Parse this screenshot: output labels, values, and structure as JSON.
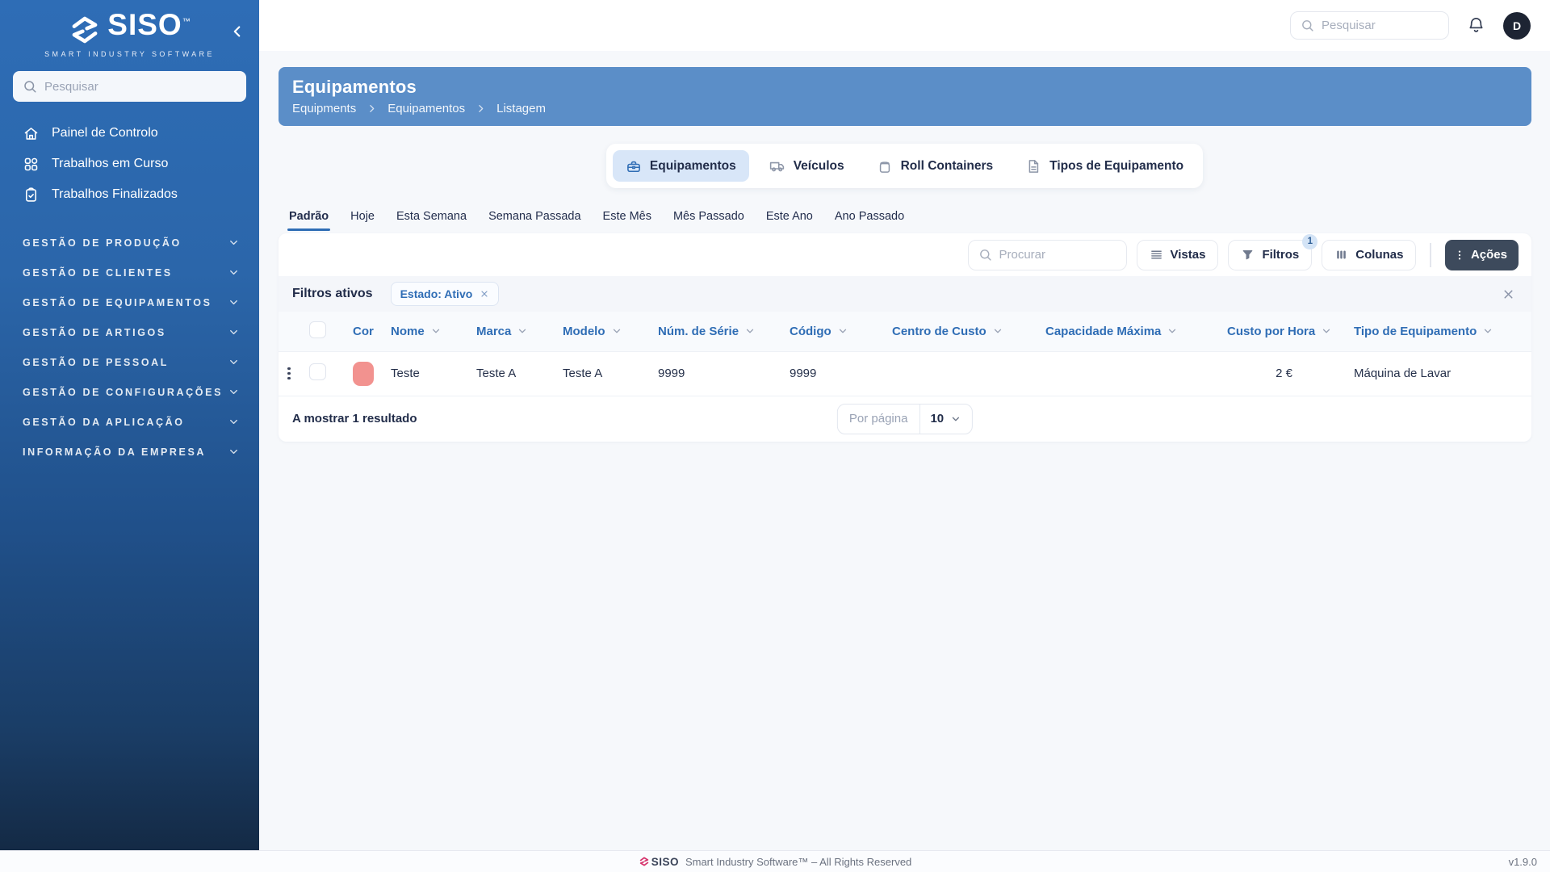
{
  "sidebar": {
    "brand": "SISO",
    "brand_tm": "™",
    "tagline": "SMART INDUSTRY SOFTWARE",
    "search_placeholder": "Pesquisar",
    "items": [
      {
        "label": "Painel de Controlo",
        "icon": "home-icon"
      },
      {
        "label": "Trabalhos em Curso",
        "icon": "grid-icon"
      },
      {
        "label": "Trabalhos Finalizados",
        "icon": "clipboard-check-icon"
      }
    ],
    "sections": [
      {
        "label": "GESTÃO DE PRODUÇÃO"
      },
      {
        "label": "GESTÃO DE CLIENTES"
      },
      {
        "label": "GESTÃO DE EQUIPAMENTOS"
      },
      {
        "label": "GESTÃO DE ARTIGOS"
      },
      {
        "label": "GESTÃO DE PESSOAL"
      },
      {
        "label": "GESTÃO DE CONFIGURAÇÕES"
      },
      {
        "label": "GESTÃO DA APLICAÇÃO"
      },
      {
        "label": "INFORMAÇÃO DA EMPRESA"
      }
    ]
  },
  "topbar": {
    "search_placeholder": "Pesquisar",
    "avatar_initial": "D"
  },
  "page_header": {
    "title": "Equipamentos",
    "breadcrumb": [
      "Equipments",
      "Equipamentos",
      "Listagem"
    ]
  },
  "entity_tabs": [
    {
      "label": "Equipamentos",
      "icon": "toolbox-icon",
      "active": true
    },
    {
      "label": "Veículos",
      "icon": "van-icon",
      "active": false
    },
    {
      "label": "Roll Containers",
      "icon": "container-icon",
      "active": false
    },
    {
      "label": "Tipos de Equipamento",
      "icon": "document-icon",
      "active": false
    }
  ],
  "period_tabs": [
    {
      "label": "Padrão",
      "active": true
    },
    {
      "label": "Hoje",
      "active": false
    },
    {
      "label": "Esta Semana",
      "active": false
    },
    {
      "label": "Semana Passada",
      "active": false
    },
    {
      "label": "Este Mês",
      "active": false
    },
    {
      "label": "Mês Passado",
      "active": false
    },
    {
      "label": "Este Ano",
      "active": false
    },
    {
      "label": "Ano Passado",
      "active": false
    }
  ],
  "toolbar": {
    "search_placeholder": "Procurar",
    "vistas_label": "Vistas",
    "filtros_label": "Filtros",
    "filtros_badge": "1",
    "colunas_label": "Colunas",
    "acoes_label": "Ações"
  },
  "active_filters": {
    "label": "Filtros ativos",
    "chips": [
      {
        "label": "Estado: Ativo"
      }
    ]
  },
  "table": {
    "columns": [
      "Cor",
      "Nome",
      "Marca",
      "Modelo",
      "Núm. de Série",
      "Código",
      "Centro de Custo",
      "Capacidade Máxima",
      "Custo por Hora",
      "Tipo de Equipamento"
    ],
    "rows": [
      {
        "color": "#f2928f",
        "nome": "Teste",
        "marca": "Teste A",
        "modelo": "Teste A",
        "num_serie": "9999",
        "codigo": "9999",
        "centro_custo": "",
        "capacidade_maxima": "",
        "custo_por_hora": "2 €",
        "tipo_equipamento": "Máquina de Lavar"
      }
    ]
  },
  "pagination": {
    "summary": "A mostrar 1 resultado",
    "per_page_label": "Por página",
    "per_page_value": "10"
  },
  "footer": {
    "brand": "SISO",
    "text": "Smart Industry Software™ – All Rights Reserved",
    "version": "v1.9.0"
  },
  "colors": {
    "accent_blue": "#2f6db5",
    "banner_blue": "#5b8ec8",
    "active_tab_bg": "#d8e6f8",
    "acoes_bg": "#3d4a5c",
    "avatar_bg": "#1d2433",
    "row_swatch": "#f2928f",
    "sidebar_gradient_top": "#2e6db6",
    "sidebar_gradient_bottom": "#142a45"
  }
}
